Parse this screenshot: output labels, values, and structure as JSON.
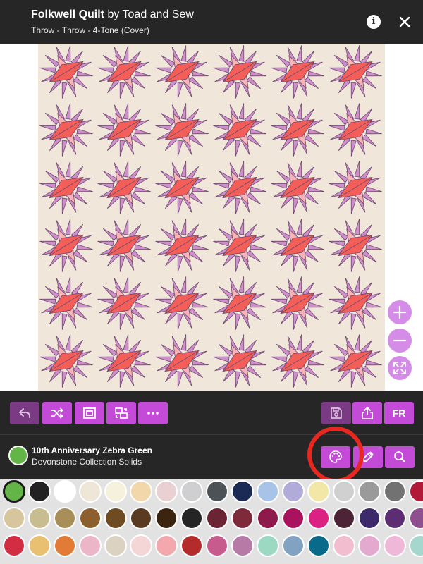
{
  "header": {
    "title_bold": "Folkwell Quilt",
    "title_rest": " by Toad and Sew",
    "subtitle": "Throw - Throw - 4-Tone (Cover)",
    "info_label": "i"
  },
  "quilt": {
    "colors": {
      "background": "#f0e6da",
      "points": "#cf8fcb",
      "petals": "#f7b3b5",
      "centers": "#f35e58",
      "outline": "#6d4a6f"
    },
    "rows": 6,
    "cols": 6
  },
  "toolbar": {
    "undo": "undo-icon",
    "shuffle": "shuffle-icon",
    "fit": "fit-icon",
    "swap": "swap-icon",
    "more": "more-icon",
    "save": "save-icon",
    "share": "share-icon",
    "lang_label": "FR"
  },
  "fabric": {
    "name": "10th Anniversary Zebra Green",
    "collection": "Devonstone Collection Solids",
    "color": "#62b546"
  },
  "palette": {
    "rows": [
      [
        "#62b546",
        "#222222",
        "#ffffff",
        "#eee6d6",
        "#f6f1dd",
        "#f1d7a9",
        "#e9d1d3",
        "#cfcfd1",
        "#4d5256",
        "#1b2a55",
        "#a7c3e8",
        "#b0abd8",
        "#f3e7a8",
        "#d0d0d0",
        "#9a9a9a",
        "#727272",
        "#b21838"
      ],
      [
        "#d7c59d",
        "#c8bd91",
        "#a88e58",
        "#8c5f2e",
        "#6f4b22",
        "#5a3a21",
        "#3b2410",
        "#252525",
        "#6b2434",
        "#7e2a3b",
        "#8d1a4a",
        "#a9125c",
        "#db2182",
        "#4c2435",
        "#3d2a6a",
        "#5c2d70",
        "#8e4f8f"
      ],
      [
        "#d32d43",
        "#e9c071",
        "#e17b35",
        "#edb6c8",
        "#dbd2c2",
        "#f5d6d6",
        "#f2a8ac",
        "#b42b2b",
        "#c75b8d",
        "#b77aa7",
        "#9bd9c3",
        "#82a2c2",
        "#0a6a8a",
        "#f3bdd0",
        "#e4a9cf",
        "#f0b8d8",
        "#a6d7cf"
      ]
    ]
  }
}
